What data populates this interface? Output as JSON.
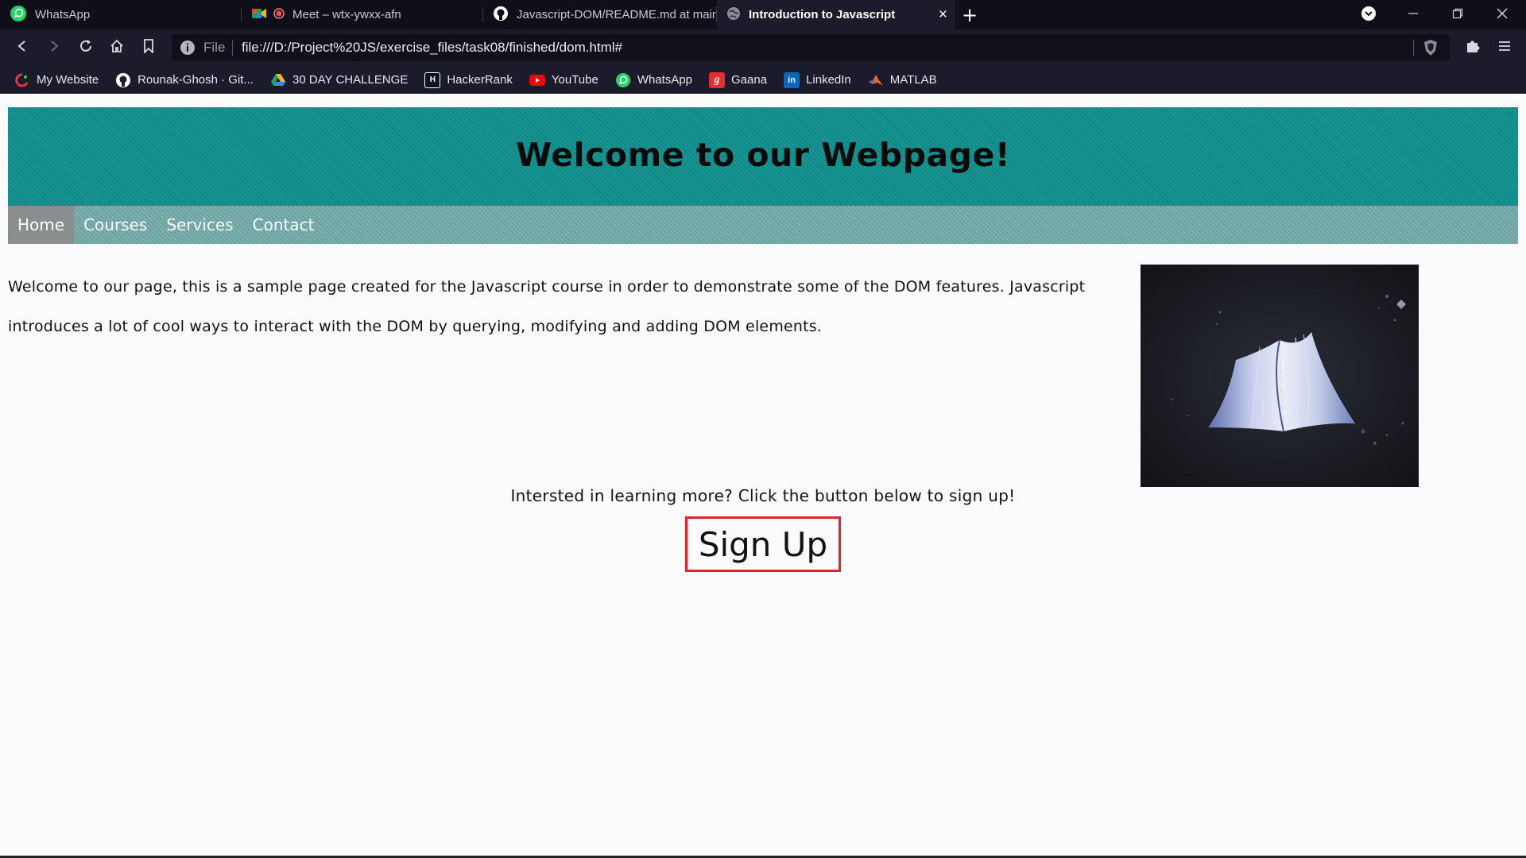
{
  "browser": {
    "tabs": [
      {
        "title": "WhatsApp",
        "icon": "whatsapp-icon",
        "active": false
      },
      {
        "title": "Meet – wtx-ywxx-afn",
        "icon": "google-meet-icon",
        "active": false
      },
      {
        "title": "Javascript-DOM/README.md at main",
        "icon": "github-icon",
        "active": false
      },
      {
        "title": "Introduction to Javascript",
        "icon": "globe-icon",
        "active": true
      }
    ],
    "address": {
      "scheme_label": "File",
      "url": "file:///D:/Project%20JS/exercise_files/task08/finished/dom.html#"
    },
    "bookmarks": [
      {
        "label": "My Website",
        "icon": "my-website-icon",
        "color": "#e2344a"
      },
      {
        "label": "Rounak-Ghosh · Git...",
        "icon": "github-icon",
        "color": "#ffffff"
      },
      {
        "label": "30 DAY CHALLENGE",
        "icon": "google-drive-icon",
        "color": "#1fa463"
      },
      {
        "label": "HackerRank",
        "icon": "hackerrank-icon",
        "color": "#2ec866"
      },
      {
        "label": "YouTube",
        "icon": "youtube-icon",
        "color": "#ff0000"
      },
      {
        "label": "WhatsApp",
        "icon": "whatsapp-icon",
        "color": "#25d366"
      },
      {
        "label": "Gaana",
        "icon": "gaana-icon",
        "color": "#e72c30"
      },
      {
        "label": "LinkedIn",
        "icon": "linkedin-icon",
        "color": "#0a66c2"
      },
      {
        "label": "MATLAB",
        "icon": "matlab-icon",
        "color": "#e16737"
      }
    ]
  },
  "page": {
    "heading": "Welcome to our Webpage!",
    "nav": [
      "Home",
      "Courses",
      "Services",
      "Contact"
    ],
    "intro": "Welcome to our page, this is a sample page created for the Javascript course in order to demonstrate some of the DOM features. Javascript introduces a lot of cool ways to interact with the DOM by querying, modifying and adding DOM elements.",
    "cta_text": "Intersted in learning more? Click the button below to sign up!",
    "signup_label": "Sign Up",
    "colors": {
      "header": "#0f8f8c",
      "nav": "#6fa8a6",
      "button_border": "#e0242c"
    }
  }
}
